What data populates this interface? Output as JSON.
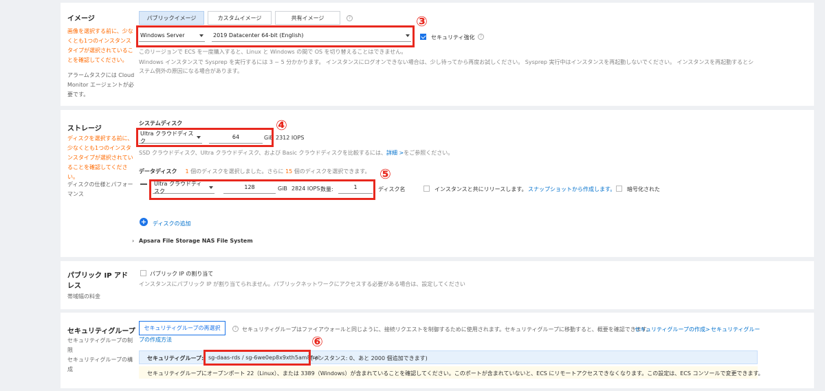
{
  "image": {
    "title": "イメージ",
    "warning": "画像を選択する前に、少なくとも1つのインスタンスタイプが選択されていることを確認してください。",
    "note": "アラームタスクには Cloud Monitor エージェントが必要です。",
    "tabs": [
      "パブリックイメージ",
      "カスタムイメージ",
      "共有イメージ"
    ],
    "os_select": "Windows Server",
    "version_select": "2019 Datacenter 64-bit (English)",
    "security_label": "セキュリティ強化",
    "info1": "このリージョンで ECS を一度購入すると、Linux と Windows の間で OS を切り替えることはできません。",
    "info2": "Windows インスタンスで Sysprep を実行するには 3 ~ 5 分かかります。 インスタンスにログオンできない場合は、少し待ってから再度お試しください。 Sysprep 実行中はインスタンスを再起動しないでください。 インスタンスを再起動するとシステム例外の原因になる場合があります。",
    "marker": "③"
  },
  "storage": {
    "title": "ストレージ",
    "warning": "ディスクを選択する前に、少なくとも1つのインスタンスタイプが選択されていることを確認してください。",
    "note": "ディスクの仕様とパフォーマンス",
    "system_disk_label": "システムディスク",
    "system_disk_type": "Ultra クラウドディスク",
    "system_disk_size": "64",
    "unit": "GiB",
    "system_iops": "2312 IOPS",
    "compare_prefix": "SSD クラウドディスク、Ultra クラウドディスク、および Basic クラウドディスクを比較するには、",
    "compare_link": "詳細 >",
    "compare_suffix": "をご参照ください。",
    "data_disk_label": "データディスク",
    "selected_prefix": "1",
    "selected_mid": " 個のディスクを選択しました。さらに ",
    "selected_more": "15",
    "selected_suffix": " 個のディスクを選択できます。",
    "data_disk_type": "Ultra クラウドディスク",
    "data_disk_size": "128",
    "data_iops": "2824 IOPS",
    "qty_label": "数量:",
    "qty": "1",
    "disk_name_label": "ディスク名",
    "release_label": "インスタンスと共にリリースします。",
    "snapshot_link": "スナップショットから作成します。",
    "encrypt_label": "暗号化された",
    "add_disk": "ディスクの追加",
    "nas": "Apsara File Storage NAS File System",
    "marker4": "④",
    "marker5": "⑤"
  },
  "public_ip": {
    "title": "パブリック IP アドレス",
    "note": "帯域幅の料金",
    "checkbox_label": "パブリック IP の割り当て",
    "info": "インスタンスにパブリック IP が割り当てられません。パブリックネットワークにアクセスする必要がある場合は、設定してください"
  },
  "security_group": {
    "title": "セキュリティグループ",
    "note1": "セキュリティグループの制限",
    "note2": "セキュリティグループの構成",
    "reselect_button": "セキュリティグループの再選択",
    "description": "セキュリティグループはファイアウォールと同じように、接続リクエストを制御するために使用されます。セキュリティグループに移動すると、概要を確認できます。",
    "create_link": "セキュリティグループの作成>",
    "howto_link_1": "セキュリティグルー",
    "howto_link_2": "プの作成方法",
    "selected_label": "セキュリティグループ:",
    "selected_value": "sg-daas-rds / sg-6we0ep8x9xth5am8frai",
    "selected_suffix": "(インスタンス: 0、あと 2000 個追加できます)",
    "warning": "セキュリティグループにオープンポート 22（Linux）、または 3389（Windows）が含まれていることを確認してください。このポートが含まれていないと、ECS にリモートアクセスできなくなります。この設定は、ECS コンソールで変更できます。",
    "marker": "⑥"
  },
  "colors": {
    "accent": "#0070cc",
    "warning_text": "#ff6a00",
    "annotation": "#e8281e",
    "active_tab": "#dbe9f9"
  }
}
